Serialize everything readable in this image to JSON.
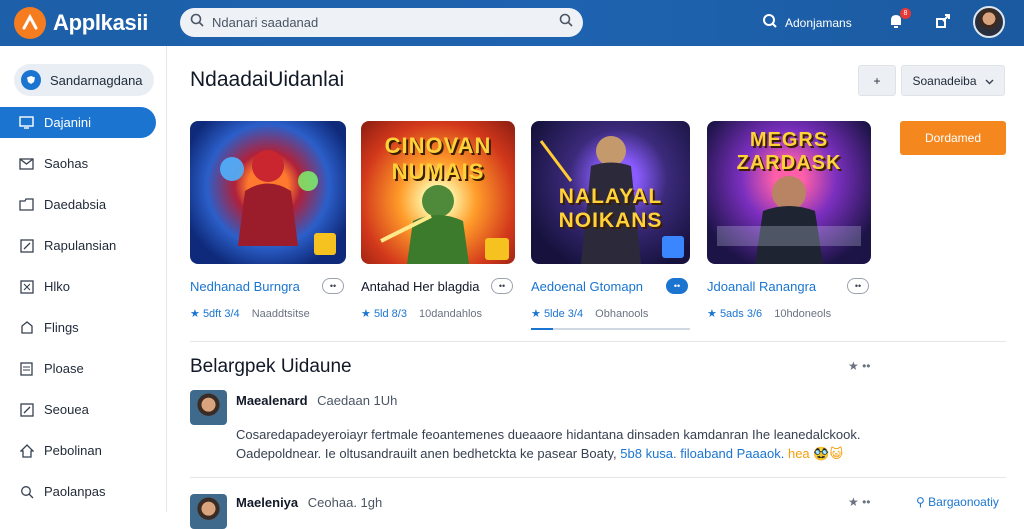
{
  "header": {
    "app_name": "Applkasii",
    "search_placeholder": "Ndanari saadanad",
    "user_label": "Adonjamans",
    "notif_count": "8"
  },
  "sidebar": {
    "top_pill": "Sandarnagdana",
    "items": [
      {
        "label": "Dajanini",
        "icon": "monitor-icon",
        "active": true
      },
      {
        "label": "Saohas",
        "icon": "mail-icon",
        "active": false
      },
      {
        "label": "Daedabsia",
        "icon": "folder-icon",
        "active": false
      },
      {
        "label": "Rapulansian",
        "icon": "edit-icon",
        "active": false
      },
      {
        "label": "Hlko",
        "icon": "grid-icon",
        "active": false
      },
      {
        "label": "Flings",
        "icon": "tag-icon",
        "active": false
      },
      {
        "label": "Ploase",
        "icon": "document-icon",
        "active": false
      },
      {
        "label": "Seouea",
        "icon": "edit-icon",
        "active": false
      },
      {
        "label": "Pebolinan",
        "icon": "home-icon",
        "active": false
      },
      {
        "label": "Paolanpas",
        "icon": "search-icon",
        "active": false
      }
    ]
  },
  "main": {
    "title": "NdaadaiUidanlai",
    "toolbar": {
      "add_label": "+",
      "sort_label": "Soanadeiba"
    },
    "cta_label": "Dordamed"
  },
  "cards": [
    {
      "name": "Nedhanad Burngra",
      "rating": "5dft 3/4",
      "stat": "Naaddtsitse",
      "more": "••",
      "art_title": ""
    },
    {
      "name": "Antahad Her blagdia",
      "rating": "5ld 8/3",
      "stat": "10dandahlos",
      "more": "••",
      "art_title": "CINOVAN NUMAIS"
    },
    {
      "name": "Aedoenal Gtomapn",
      "rating": "5lde 3/4",
      "stat": "Obhanools",
      "more": "••",
      "art_title": "NALAYAL NOIKANS"
    },
    {
      "name": "Jdoanall Ranangra",
      "rating": "5ads 3/6",
      "stat": "10hdoneols",
      "more": "••",
      "art_title": "MEGRS ZARDASK"
    }
  ],
  "section": {
    "title": "Belargpek Uidaune",
    "actions": "★ ••"
  },
  "posts": [
    {
      "author": "Maealenard",
      "meta": "Caedaan  1Uh",
      "body_1": "Cosaredapadeyeroiayr fertmale feoantemenes dueaaore hidantana dinsaden kamdanran Ihe leanedalckook.",
      "body_2_plain": "Oadepoldnear. Ie oltusandrauilt anen bedhetckta ke pasear Boaty,",
      "body_2_hl": "5b8 kusa. filoaband  Paaaok.",
      "body_2_hl2": "hea 🥸😺"
    },
    {
      "author": "Maeleniya",
      "meta": "Ceohaa. 1gh",
      "link": "Bargaonoatiy"
    }
  ],
  "colors": {
    "primary": "#1b75d0",
    "header": "#1d5fa8",
    "accent": "#f5871f"
  }
}
